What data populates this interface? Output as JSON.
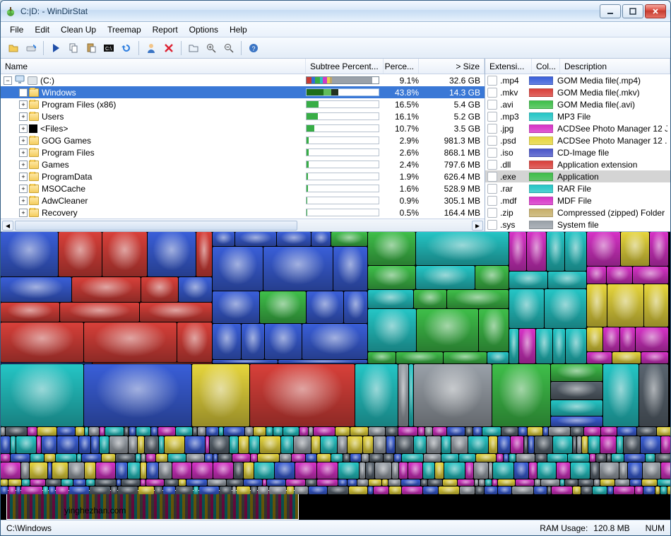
{
  "window": {
    "title": "C:|D: - WinDirStat"
  },
  "menu": {
    "items": [
      "File",
      "Edit",
      "Clean Up",
      "Treemap",
      "Report",
      "Options",
      "Help"
    ]
  },
  "toolbar": {
    "buttons": [
      {
        "name": "open-icon"
      },
      {
        "name": "refresh-drives-icon"
      },
      {
        "sep": true
      },
      {
        "name": "play-icon"
      },
      {
        "name": "copy-icon"
      },
      {
        "name": "paste-icon"
      },
      {
        "name": "console-icon"
      },
      {
        "name": "reload-icon"
      },
      {
        "sep": true
      },
      {
        "name": "user-cleanup-icon"
      },
      {
        "name": "delete-icon"
      },
      {
        "sep": true
      },
      {
        "name": "open-folder-icon"
      },
      {
        "name": "zoom-in-icon"
      },
      {
        "name": "zoom-out-icon"
      },
      {
        "sep": true
      },
      {
        "name": "help-icon"
      }
    ]
  },
  "left": {
    "columns": {
      "name": "Name",
      "subtree": "Subtree Percent...",
      "perc": "Perce...",
      "size": "> Size"
    },
    "root": {
      "name": "(C:)",
      "root_bar": [
        {
          "color": "#c63b33",
          "w": 7
        },
        {
          "color": "#2e6ed8",
          "w": 5
        },
        {
          "color": "#38ad46",
          "w": 7
        },
        {
          "color": "#29c2c2",
          "w": 4
        },
        {
          "color": "#d338c7",
          "w": 5
        },
        {
          "color": "#e8d24b",
          "w": 4
        },
        {
          "color": "#bfa66a",
          "w": 3
        },
        {
          "color": "#9aa1a9",
          "w": 56
        }
      ],
      "perc": "9.1%",
      "size": "32.6 GB"
    },
    "children": [
      {
        "name": "Windows",
        "sel": true,
        "bar": [
          {
            "c": "#1e6e18",
            "w": 24
          },
          {
            "c": "#5fbc5a",
            "w": 10
          },
          {
            "c": "#22321f",
            "w": 10
          }
        ],
        "perc": "43.8%",
        "size": "14.3 GB"
      },
      {
        "name": "Program Files (x86)",
        "bar": [
          {
            "c": "#38ad46",
            "w": 17
          }
        ],
        "perc": "16.5%",
        "size": "5.4 GB"
      },
      {
        "name": "Users",
        "bar": [
          {
            "c": "#38ad46",
            "w": 16
          }
        ],
        "perc": "16.1%",
        "size": "5.2 GB"
      },
      {
        "name": "<Files>",
        "icon": "black",
        "bar": [
          {
            "c": "#38ad46",
            "w": 11
          }
        ],
        "perc": "10.7%",
        "size": "3.5 GB"
      },
      {
        "name": "GOG Games",
        "bar": [
          {
            "c": "#38ad46",
            "w": 3
          }
        ],
        "perc": "2.9%",
        "size": "981.3 MB"
      },
      {
        "name": "Program Files",
        "bar": [
          {
            "c": "#38ad46",
            "w": 3
          }
        ],
        "perc": "2.6%",
        "size": "868.1 MB"
      },
      {
        "name": "Games",
        "bar": [
          {
            "c": "#38ad46",
            "w": 3
          }
        ],
        "perc": "2.4%",
        "size": "797.6 MB"
      },
      {
        "name": "ProgramData",
        "bar": [
          {
            "c": "#38ad46",
            "w": 2
          }
        ],
        "perc": "1.9%",
        "size": "626.4 MB"
      },
      {
        "name": "MSOCache",
        "bar": [
          {
            "c": "#38ad46",
            "w": 2
          }
        ],
        "perc": "1.6%",
        "size": "528.9 MB"
      },
      {
        "name": "AdwCleaner",
        "bar": [
          {
            "c": "#38ad46",
            "w": 1
          }
        ],
        "perc": "0.9%",
        "size": "305.1 MB"
      },
      {
        "name": "Recovery",
        "bar": [
          {
            "c": "#38ad46",
            "w": 1
          }
        ],
        "perc": "0.5%",
        "size": "164.4 MB"
      }
    ]
  },
  "right": {
    "columns": {
      "ext": "Extensi...",
      "col": "Col...",
      "desc": "Description"
    },
    "rows": [
      {
        "ext": ".mp4",
        "color": "#3a5fd9",
        "desc": "GOM Media file(.mp4)"
      },
      {
        "ext": ".mkv",
        "color": "#d9403a",
        "desc": "GOM Media file(.mkv)"
      },
      {
        "ext": ".avi",
        "color": "#3fbf4a",
        "desc": "GOM Media file(.avi)"
      },
      {
        "ext": ".mp3",
        "color": "#25c6c6",
        "desc": "MP3 File"
      },
      {
        "ext": ".jpg",
        "color": "#d733c7",
        "desc": "ACDSee Photo Manager 12 J."
      },
      {
        "ext": ".psd",
        "color": "#e7d63d",
        "desc": "ACDSee Photo Manager 12 ."
      },
      {
        "ext": ".iso",
        "color": "#4a56c9",
        "desc": "CD-Image file"
      },
      {
        "ext": ".dll",
        "color": "#d9403a",
        "desc": "Application extension"
      },
      {
        "ext": ".exe",
        "color": "#3fbf4a",
        "desc": "Application",
        "sel": true
      },
      {
        "ext": ".rar",
        "color": "#25c6c6",
        "desc": "RAR File"
      },
      {
        "ext": ".mdf",
        "color": "#d733c7",
        "desc": "MDF File"
      },
      {
        "ext": ".zip",
        "color": "#c7b06b",
        "desc": "Compressed (zipped) Folder"
      },
      {
        "ext": ".sys",
        "color": "#9aa1a9",
        "desc": "System file"
      }
    ]
  },
  "status": {
    "path": "C:\\Windows",
    "ram_label": "RAM Usage:",
    "ram_value": "120.8 MB",
    "num": "NUM"
  },
  "watermark": "yinghezhan.com"
}
